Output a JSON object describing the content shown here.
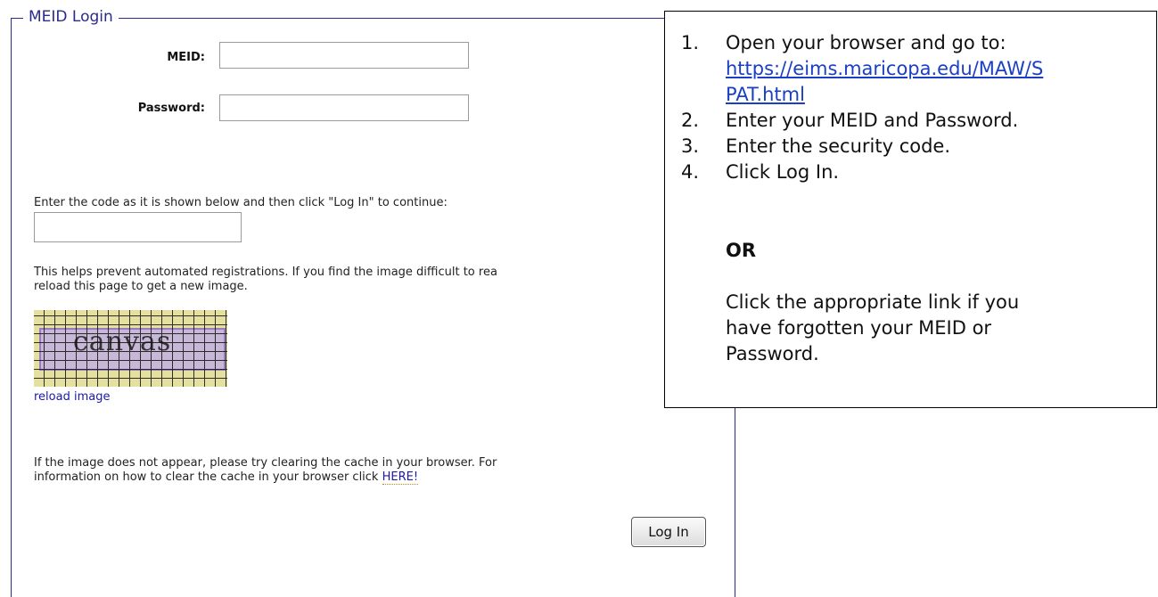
{
  "login_form": {
    "legend": "MEID Login",
    "meid_label": "MEID:",
    "meid_value": "",
    "password_label": "Password:",
    "password_value": "",
    "code_prompt": "Enter the code as it is shown below and then click \"Log In\" to continue:",
    "code_value": "",
    "help_text_line1": "This helps prevent automated registrations. If you find the image difficult to rea",
    "help_text_line2": "reload this page to get a new image.",
    "captcha_word": "canvas",
    "reload_link": "reload image",
    "cache_text_line1": "If the image does not appear, please try clearing the cache in your browser. For",
    "cache_text_line2": "information on how to clear the cache in your browser click",
    "here_link": "HERE!",
    "login_button": "Log In"
  },
  "instructions": {
    "step1_num": "1.",
    "step1_text": "Open your browser and go to:",
    "step1_url_line1": "https://eims.maricopa.edu/MAW/S",
    "step1_url_line2": "PAT.html",
    "step2_num": "2.",
    "step2_text": "Enter your MEID and Password.",
    "step3_num": "3.",
    "step3_text": "Enter the security code.",
    "step4_num": "4.",
    "step4_text": "Click Log In.",
    "or_text": "OR",
    "alt_line1": "Click the appropriate link if you",
    "alt_line2": "have forgotten your MEID or",
    "alt_line3": "Password."
  },
  "colors": {
    "frame": "#2a2a8a",
    "link": "#1a1aa8",
    "url": "#1a3fc4"
  }
}
